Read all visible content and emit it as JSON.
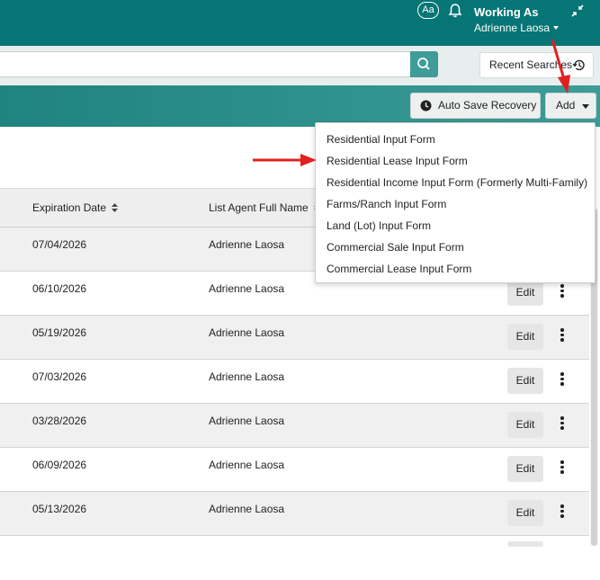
{
  "header": {
    "font_size_button": "Aa",
    "working_as_title": "Working As",
    "working_as_user": "Adrienne Laosa",
    "icons": [
      "bell-icon",
      "collapse-arrows-icon",
      "chevron-down-icon"
    ]
  },
  "search": {
    "value": "",
    "recent_label": "Recent Searches",
    "icons": [
      "search-icon",
      "history-icon"
    ]
  },
  "toolbar": {
    "autosave_label": "Auto Save Recovery",
    "add_label": "Add"
  },
  "add_menu": {
    "items": [
      "Residential Input Form",
      "Residential Lease Input Form",
      "Residential Income Input Form (Formerly Multi-Family)",
      "Farms/Ranch Input Form",
      "Land (Lot) Input Form",
      "Commercial Sale Input Form",
      "Commercial Lease Input Form"
    ]
  },
  "table": {
    "columns": [
      "Expiration Date",
      "List Agent Full Name"
    ],
    "edit_label": "Edit",
    "rows": [
      {
        "expiration": "07/04/2026",
        "agent": "Adrienne Laosa"
      },
      {
        "expiration": "06/10/2026",
        "agent": "Adrienne Laosa"
      },
      {
        "expiration": "05/19/2026",
        "agent": "Adrienne Laosa"
      },
      {
        "expiration": "07/03/2026",
        "agent": "Adrienne Laosa"
      },
      {
        "expiration": "03/28/2026",
        "agent": "Adrienne Laosa"
      },
      {
        "expiration": "06/09/2026",
        "agent": "Adrienne Laosa"
      },
      {
        "expiration": "05/13/2026",
        "agent": "Adrienne Laosa"
      }
    ]
  },
  "colors": {
    "header_teal": "#077575",
    "search_button": "#3f9c98",
    "annotation_arrow": "#e02020"
  }
}
